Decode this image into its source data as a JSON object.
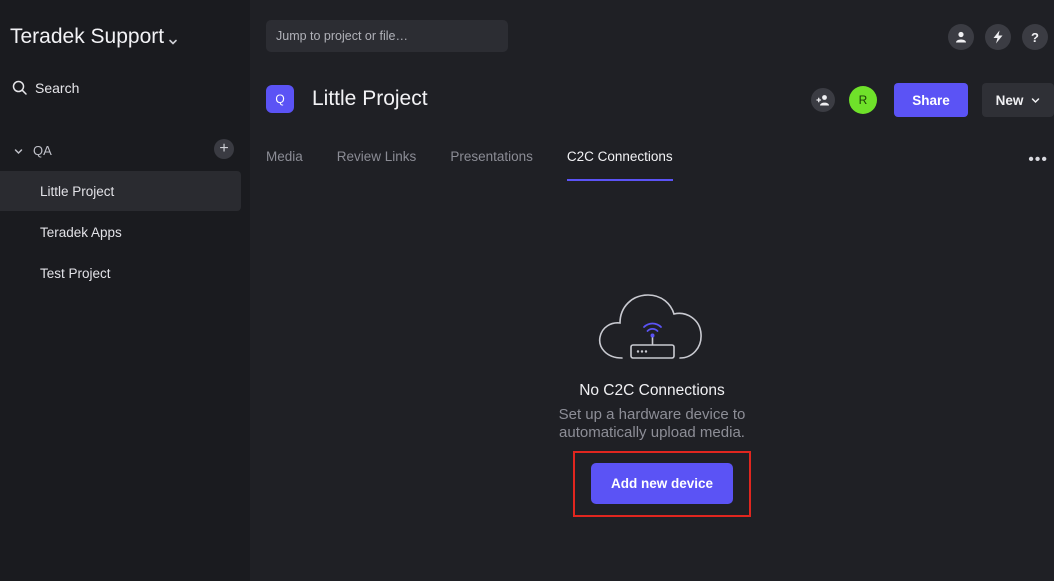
{
  "sidebar": {
    "workspace_name": "Teradek Support",
    "search_label": "Search",
    "team_name": "QA",
    "add_label": "+",
    "projects": [
      "Little Project",
      "Teradek Apps",
      "Test Project"
    ],
    "active_project": "Little Project"
  },
  "topbar": {
    "jump_placeholder": "Jump to project or file…",
    "icons": [
      "user-icon",
      "lightning-icon",
      "help-icon"
    ],
    "help_label": "?"
  },
  "project": {
    "badge_letter": "Q",
    "title": "Little Project",
    "avatar_initial": "R",
    "share_label": "Share",
    "new_label": "New"
  },
  "tabs": {
    "items": [
      "Media",
      "Review Links",
      "Presentations",
      "C2C Connections"
    ],
    "active": "C2C Connections",
    "more_label": "•••"
  },
  "empty_state": {
    "icon": "cloud-router-icon",
    "title": "No C2C Connections",
    "subtitle_line1": "Set up a hardware device to",
    "subtitle_line2": "automatically upload media.",
    "button_label": "Add new device"
  },
  "colors": {
    "accent": "#5b53f5",
    "background": "#1f2025",
    "sidebar": "#1a1b1f",
    "avatar": "#6fe12a",
    "highlight_box": "#e0261f"
  }
}
